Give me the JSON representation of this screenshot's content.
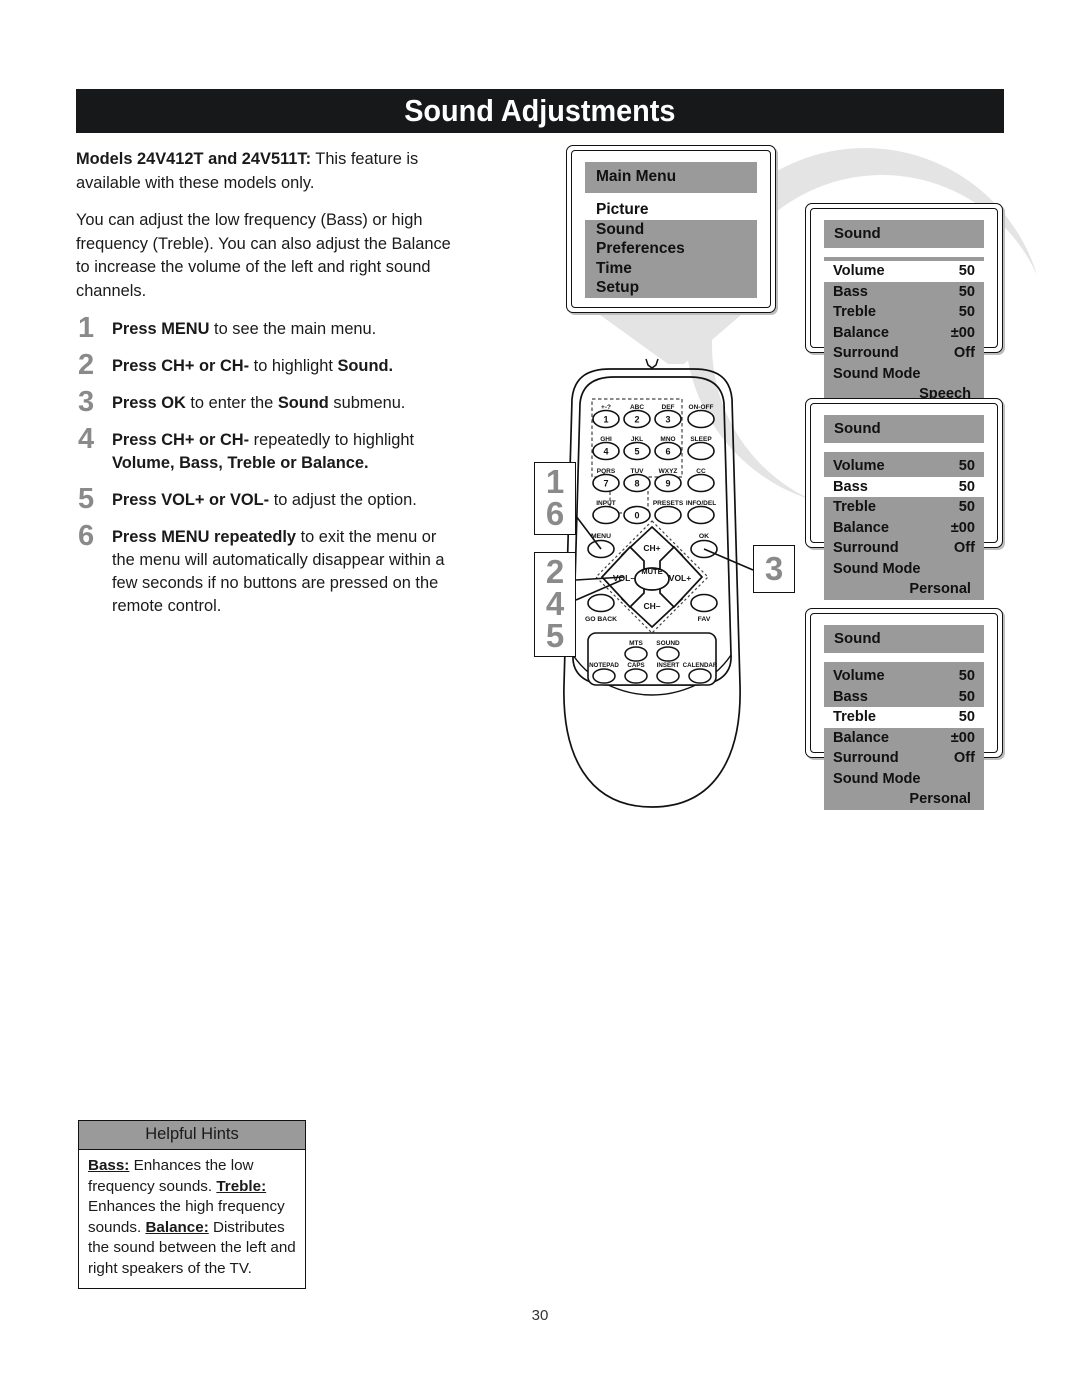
{
  "header": {
    "title": "Sound Adjustments"
  },
  "intro": [
    {
      "bold": "Models 24V412T and 24V511T:",
      "rest": " This feature is available with these models only."
    },
    {
      "bold": "",
      "rest": "You can adjust the low frequency (Bass) or high frequency (Treble). You can also adjust the Balance to increase the volume of the left and right sound channels."
    }
  ],
  "intro_p1_bold": "Models 24V412T and 24V511T:",
  "intro_p1_rest": " This feature is available with these models only.",
  "intro_p2": "You can adjust the low frequency (Bass) or high frequency (Treble). You can also adjust the Balance to increase the volume of the left and right sound channels.",
  "steps": [
    {
      "num": "1",
      "b1": "Press MENU",
      "t1": " to see the main menu.",
      "b2": "",
      "t2": ""
    },
    {
      "num": "2",
      "b1": "Press CH+ or CH-",
      "t1": " to highlight ",
      "b2": "Sound.",
      "t2": ""
    },
    {
      "num": "3",
      "b1": "Press OK",
      "t1": " to enter the ",
      "b2": "Sound",
      "t2": " submenu."
    },
    {
      "num": "4",
      "b1": "Press CH+ or CH-",
      "t1": " repeatedly to highlight ",
      "b2": "Volume, Bass, Treble or Balance.",
      "t2": ""
    },
    {
      "num": "5",
      "b1": "Press VOL+ or VOL-",
      "t1": " to adjust the option.",
      "b2": "",
      "t2": ""
    },
    {
      "num": "6",
      "b1": "Press MENU repeatedly",
      "t1": " to exit the menu or the menu will automatically disappear within a few seconds if no buttons are pressed on the remote control.",
      "b2": "",
      "t2": ""
    }
  ],
  "hints": {
    "heading": "Helpful Hints",
    "items": [
      {
        "term": "Bass:",
        "text": " Enhances the low frequency sounds."
      },
      {
        "term": "Treble:",
        "text": " Enhances the high frequency sounds."
      },
      {
        "term": "Balance:",
        "text": " Distributes the sound between the left and right speakers of the TV."
      }
    ]
  },
  "main_menu": {
    "title": "Main Menu",
    "items": [
      {
        "label": "Picture",
        "highlighted": true
      },
      {
        "label": "Sound",
        "highlighted": false
      },
      {
        "label": "Preferences",
        "highlighted": false
      },
      {
        "label": "Time",
        "highlighted": false
      },
      {
        "label": "Setup",
        "highlighted": false
      }
    ]
  },
  "sound_menus": [
    {
      "title": "Sound",
      "highlight": "Volume",
      "rows": [
        {
          "label": "Volume",
          "value": "50"
        },
        {
          "label": "Bass",
          "value": "50"
        },
        {
          "label": "Treble",
          "value": "50"
        },
        {
          "label": "Balance",
          "value": "±00"
        },
        {
          "label": "Surround",
          "value": "Off"
        }
      ],
      "mode_label": "Sound Mode",
      "mode_value": "Speech"
    },
    {
      "title": "Sound",
      "highlight": "Bass",
      "rows": [
        {
          "label": "Volume",
          "value": "50"
        },
        {
          "label": "Bass",
          "value": "50"
        },
        {
          "label": "Treble",
          "value": "50"
        },
        {
          "label": "Balance",
          "value": "±00"
        },
        {
          "label": "Surround",
          "value": "Off"
        }
      ],
      "mode_label": "Sound Mode",
      "mode_value": "Personal"
    },
    {
      "title": "Sound",
      "highlight": "Treble",
      "rows": [
        {
          "label": "Volume",
          "value": "50"
        },
        {
          "label": "Bass",
          "value": "50"
        },
        {
          "label": "Treble",
          "value": "50"
        },
        {
          "label": "Balance",
          "value": "±00"
        },
        {
          "label": "Surround",
          "value": "Off"
        }
      ],
      "mode_label": "Sound Mode",
      "mode_value": "Personal"
    }
  ],
  "remote": {
    "keypad": [
      {
        "letters": "+-?",
        "digit": "1"
      },
      {
        "letters": "ABC",
        "digit": "2"
      },
      {
        "letters": "DEF",
        "digit": "3"
      },
      {
        "letters": "GHI",
        "digit": "4"
      },
      {
        "letters": "JKL",
        "digit": "5"
      },
      {
        "letters": "MNO",
        "digit": "6"
      },
      {
        "letters": "PQRS",
        "digit": "7"
      },
      {
        "letters": "TUV",
        "digit": "8"
      },
      {
        "letters": "WXYZ",
        "digit": "9"
      }
    ],
    "zero": "0",
    "right_column": [
      "ON-OFF",
      "SLEEP",
      "CC",
      "INFO/DEL"
    ],
    "input_label": "INPUT",
    "presets_label": "PRESETS",
    "menu_label": "MENU",
    "ok_label": "OK",
    "goback_label": "GO BACK",
    "fav_label": "FAV",
    "nav": {
      "up": "CH+",
      "down": "CH–",
      "left": "VOL–",
      "right": "VOL+",
      "center": "MUTE"
    },
    "bottom_row1": [
      "MTS",
      "SOUND"
    ],
    "bottom_row2": [
      "NOTEPAD",
      "CAPS",
      "INSERT",
      "CALENDAR"
    ]
  },
  "callouts": [
    {
      "id": "c16",
      "lines": [
        "1",
        "6"
      ],
      "target": "menu-button"
    },
    {
      "id": "c245",
      "lines": [
        "2",
        "4",
        "5"
      ],
      "target": "nav-pad"
    },
    {
      "id": "c3",
      "lines": [
        "3"
      ],
      "target": "ok-button"
    }
  ],
  "footer": {
    "page_number": "30"
  },
  "colors": {
    "title_bar": "#17181a",
    "osd_gray": "#9a9a9a",
    "step_number": "#8a8a8a",
    "decor_gray": "#e4e4e4"
  }
}
